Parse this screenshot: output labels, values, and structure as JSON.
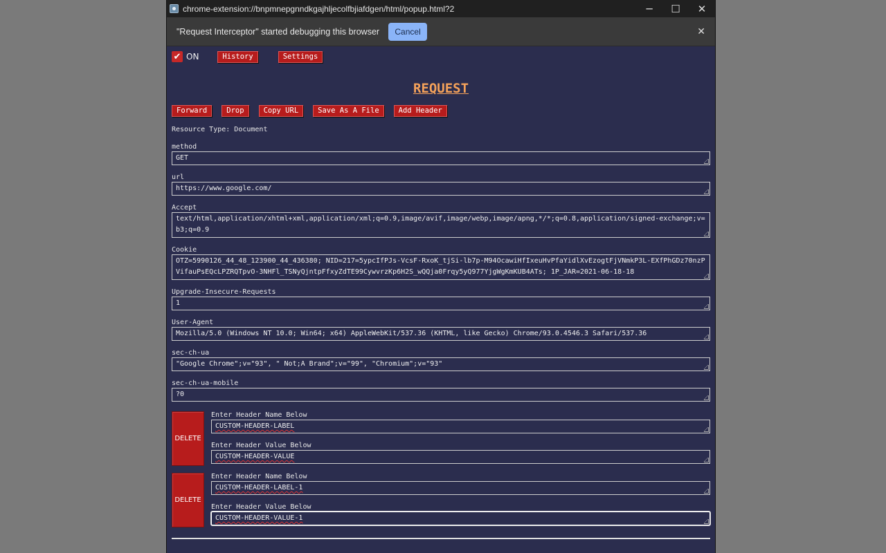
{
  "window": {
    "title": "chrome-extension://bnpmnepgnndkgajhljecolfbjiafdgen/html/popup.html?2",
    "minimize": "─",
    "maximize": "☐",
    "close": "✕"
  },
  "infobar": {
    "message": "\"Request Interceptor\" started debugging this browser",
    "cancel_label": "Cancel",
    "close": "✕"
  },
  "toolbar": {
    "check": "✔",
    "on_label": "ON",
    "history_label": "History",
    "settings_label": "Settings"
  },
  "heading": "REQUEST",
  "actions": {
    "forward": "Forward",
    "drop": "Drop",
    "copy_url": "Copy URL",
    "save_file": "Save As A File",
    "add_header": "Add Header"
  },
  "resource_type": "Resource Type: Document",
  "fields": {
    "method": {
      "label": "method",
      "value": "GET"
    },
    "url": {
      "label": "url",
      "value": "https://www.google.com/"
    },
    "accept": {
      "label": "Accept",
      "value": "text/html,application/xhtml+xml,application/xml;q=0.9,image/avif,image/webp,image/apng,*/*;q=0.8,application/signed-exchange;v=b3;q=0.9"
    },
    "cookie": {
      "label": "Cookie",
      "value": "OTZ=5990126_44_48_123900_44_436380; NID=217=5ypcIfPJs-VcsF-RxoK_tjSi-lb7p-M94OcawiHfIxeuHvPfaYidlXvEzogtFjVNmkP3L-EXfPhGDz70nzPVifauPsEQcLPZRQTpvO-3NHFl_TSNyQjntpFfxyZdTE99CywvrzKp6H2S_wQQja0Frqy5yQ977YjgWgKmKUB4ATs; 1P_JAR=2021-06-18-18"
    },
    "upgrade": {
      "label": "Upgrade-Insecure-Requests",
      "value": "1"
    },
    "user_agent": {
      "label": "User-Agent",
      "value": "Mozilla/5.0 (Windows NT 10.0; Win64; x64) AppleWebKit/537.36 (KHTML, like Gecko) Chrome/93.0.4546.3 Safari/537.36"
    },
    "sec_ch_ua": {
      "label": "sec-ch-ua",
      "value": "\"Google Chrome\";v=\"93\", \" Not;A Brand\";v=\"99\", \"Chromium\";v=\"93\""
    },
    "sec_ch_ua_mobile": {
      "label": "sec-ch-ua-mobile",
      "value": "?0"
    }
  },
  "custom_headers": [
    {
      "delete": "DELETE",
      "name_label": "Enter Header Name Below",
      "name": "CUSTOM-HEADER-LABEL",
      "value_label": "Enter Header Value Below",
      "value": "CUSTOM-HEADER-VALUE"
    },
    {
      "delete": "DELETE",
      "name_label": "Enter Header Name Below",
      "name": "CUSTOM-HEADER-LABEL-1",
      "value_label": "Enter Header Value Below",
      "value": "CUSTOM-HEADER-VALUE-1"
    }
  ]
}
